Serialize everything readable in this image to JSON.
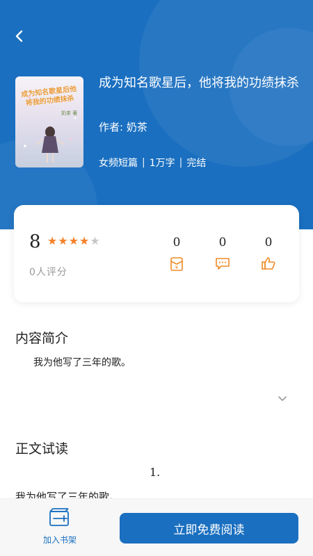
{
  "book": {
    "title": "成为知名歌星后，他将我的功绩抹杀",
    "author": "作者: 奶茶",
    "meta": [
      "女频短篇",
      "1万字",
      "完结"
    ],
    "cover_title": "成为知名歌星后他将我的功绩抹杀",
    "cover_author": "奶茶 著"
  },
  "rating": {
    "score": "8",
    "stars_filled": 4,
    "stars_total": 5,
    "count_label": "0人评分"
  },
  "stats": [
    {
      "name": "reward",
      "value": "0",
      "icon": "red-envelope-icon"
    },
    {
      "name": "comments",
      "value": "0",
      "icon": "comment-icon"
    },
    {
      "name": "likes",
      "value": "0",
      "icon": "thumbs-up-icon"
    }
  ],
  "intro": {
    "title": "内容简介",
    "text": "我为他写了三年的歌。"
  },
  "preview": {
    "title": "正文试读",
    "chapter": "1.",
    "text": "我为他写了三年的歌。"
  },
  "actions": {
    "shelf_label": "加入书架",
    "read_label": "立即免费阅读"
  },
  "colors": {
    "primary": "#1a6fc0",
    "star": "#f5812a",
    "star_empty": "#c8c8c8",
    "stat_icon": "#f08a24"
  }
}
